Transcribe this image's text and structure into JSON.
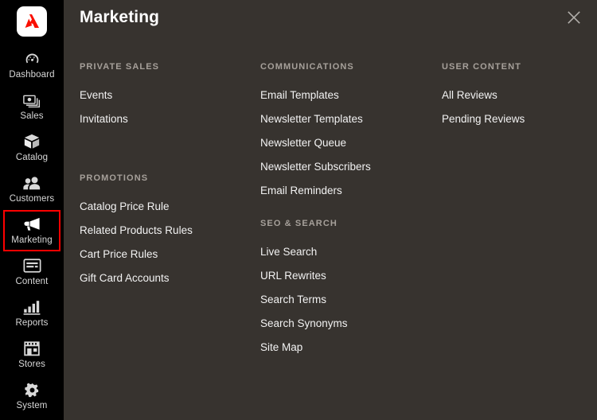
{
  "sidebar": {
    "logo": {
      "name": "adobe-logo",
      "letter": "A",
      "color": "#fa0f00"
    },
    "items": [
      {
        "label": "Dashboard",
        "icon": "dashboard-icon",
        "selected": false
      },
      {
        "label": "Sales",
        "icon": "sales-icon",
        "selected": false
      },
      {
        "label": "Catalog",
        "icon": "catalog-icon",
        "selected": false
      },
      {
        "label": "Customers",
        "icon": "customers-icon",
        "selected": false
      },
      {
        "label": "Marketing",
        "icon": "marketing-icon",
        "selected": true
      },
      {
        "label": "Content",
        "icon": "content-icon",
        "selected": false
      },
      {
        "label": "Reports",
        "icon": "reports-icon",
        "selected": false
      },
      {
        "label": "Stores",
        "icon": "stores-icon",
        "selected": false
      },
      {
        "label": "System",
        "icon": "system-icon",
        "selected": false
      }
    ],
    "selection_highlight_color": "#ff0000"
  },
  "header": {
    "title": "Marketing",
    "close_label": "close-icon"
  },
  "menu": {
    "column1": [
      {
        "title": "PRIVATE SALES",
        "items": [
          "Events",
          "Invitations"
        ]
      },
      {
        "title": "PROMOTIONS",
        "items": [
          "Catalog Price Rule",
          "Related Products Rules",
          "Cart Price Rules",
          "Gift Card Accounts"
        ]
      }
    ],
    "column2": [
      {
        "title": "COMMUNICATIONS",
        "items": [
          "Email Templates",
          "Newsletter Templates",
          "Newsletter Queue",
          "Newsletter Subscribers",
          "Email Reminders"
        ]
      },
      {
        "title": "SEO & SEARCH",
        "items": [
          "Live Search",
          "URL Rewrites",
          "Search Terms",
          "Search Synonyms",
          "Site Map"
        ]
      }
    ],
    "column3": [
      {
        "title": "USER CONTENT",
        "items": [
          "All Reviews",
          "Pending Reviews"
        ]
      }
    ]
  },
  "colors": {
    "sidebar_bg": "#000000",
    "panel_bg": "#37332f",
    "accent_red": "#fa0f00",
    "text_primary": "#f2f2f2",
    "text_muted": "#a6a09a"
  }
}
